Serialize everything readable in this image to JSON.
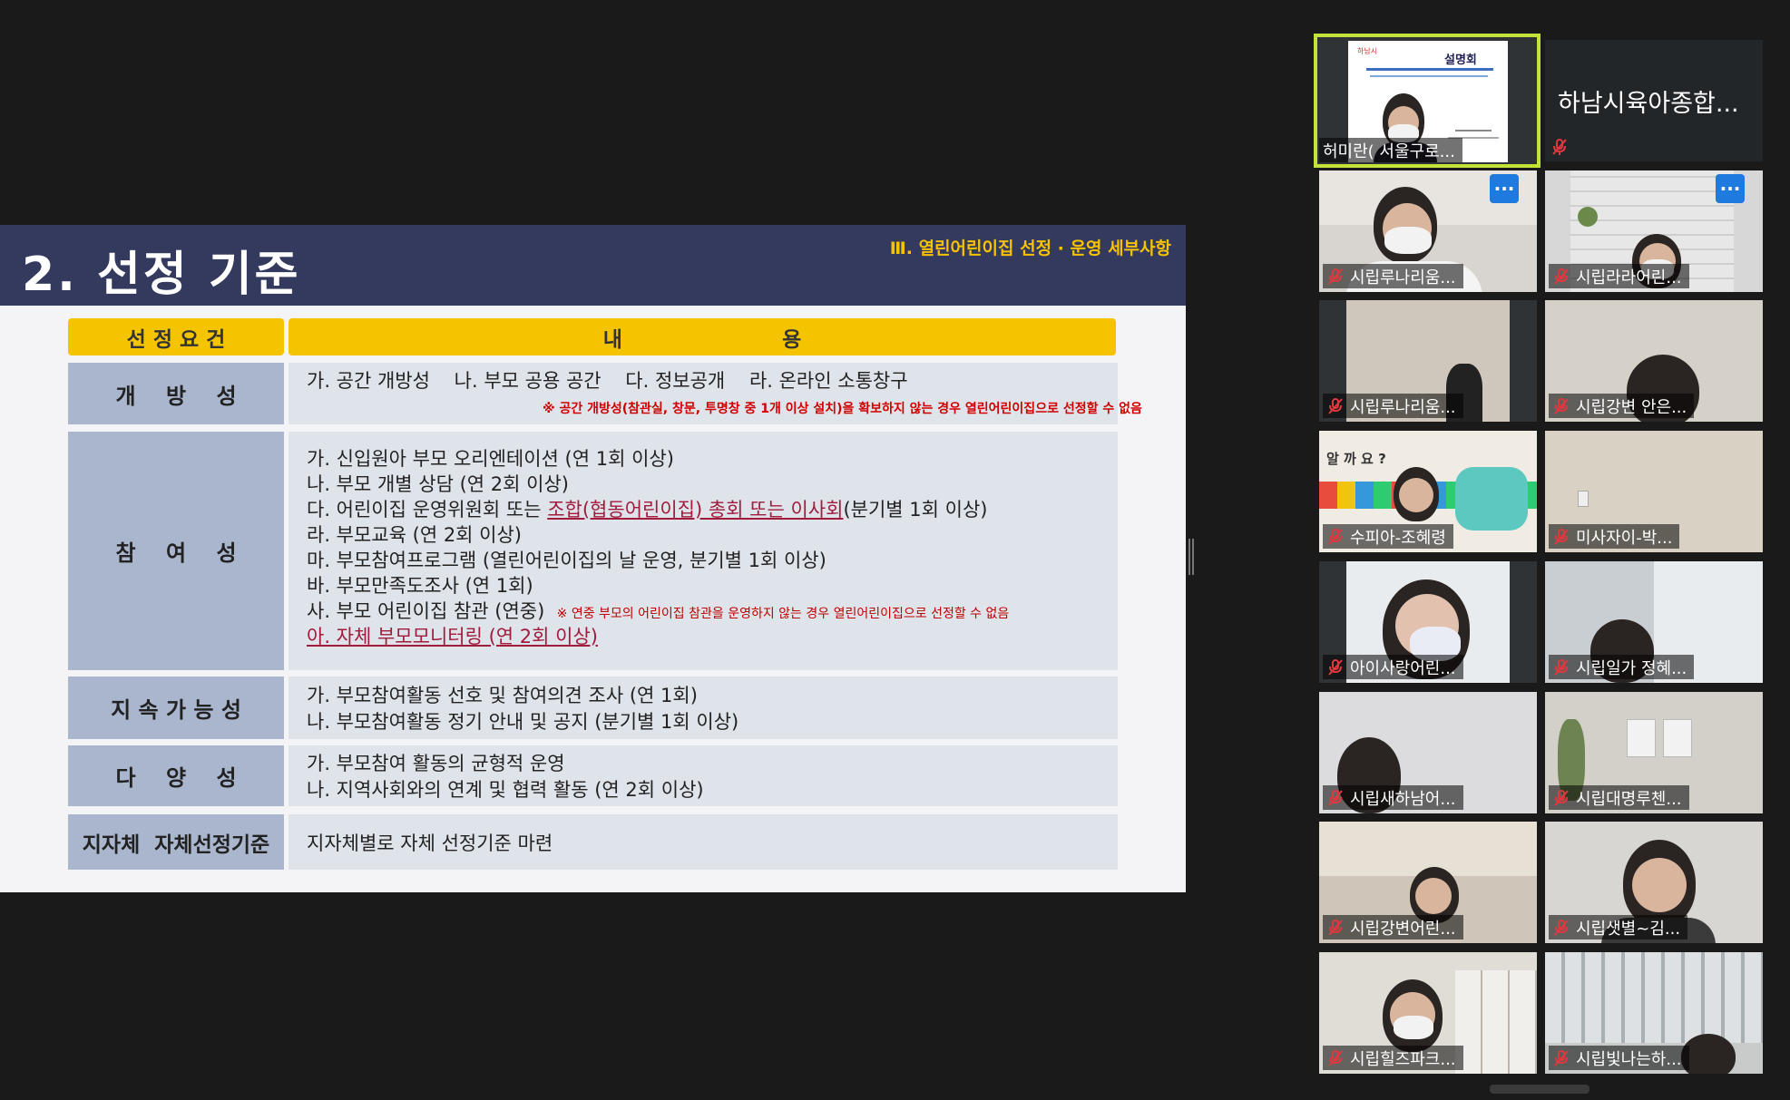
{
  "slide": {
    "title": "2. 선정 기준",
    "section": "Ⅲ. 열린어린이집 선정 · 운영 세부사항",
    "table": {
      "header_criteria": "선 정 요 건",
      "header_content": "내                      용",
      "rows": [
        {
          "label": "개    방    성",
          "line1": "가. 공간 개방성    나. 부모 공용 공간    다. 정보공개    라. 온라인 소통창구",
          "note": "※ 공간 개방성(참관실, 창문, 투명창 중 1개 이상 설치)을 확보하지 않는 경우 열린어린이집으로 선정할 수 없음"
        },
        {
          "label": "참    여    성",
          "items": [
            "가. 신입원아 부모 오리엔테이션 (연 1회 이상)",
            "나. 부모 개별 상담 (연 2회 이상)"
          ],
          "item_da_prefix": "다. 어린이집 운영위원회 또는 ",
          "item_da_highlight": "조합(협동어린이집) 총회 또는 이사회",
          "item_da_suffix": "(분기별 1회 이상)",
          "items2": [
            "라. 부모교육 (연 2회 이상)",
            "마. 부모참여프로그램 (열린어린이집의 날 운영, 분기별 1회 이상)",
            "바. 부모만족도조사 (연 1회)"
          ],
          "item_sa": "사. 부모 어린이집 참관 (연중)",
          "item_sa_note": "※ 연중 부모의 어린이집 참관을 운영하지 않는 경우 열린어린이집으로 선정할 수 없음",
          "item_a": "아. 자체 부모모니터링 (연 2회 이상)"
        },
        {
          "label": "지 속 가 능 성",
          "items": [
            "가. 부모참여활동 선호 및 참여의견 조사 (연 1회)",
            "나. 부모참여활동 정기 안내 및 공지 (분기별 1회 이상)"
          ]
        },
        {
          "label": "다    양    성",
          "items": [
            "가. 부모참여 활동의 균형적 운영",
            "나. 지역사회와의 연계 및 협력 활동 (연 2회 이상)"
          ]
        },
        {
          "label": "지자체  자체선정기준",
          "items": [
            "지자체별로 자체 선정기준 마련"
          ]
        }
      ]
    }
  },
  "gallery": {
    "active_speaker": {
      "name": "허미란( 서울구로...",
      "slide_title": "설명회",
      "slide_top": "하남시"
    },
    "name_only_tile": "하남시육아종합...",
    "tiles": [
      {
        "name": "시립루나리움...",
        "more": "···"
      },
      {
        "name": "시립라라어린...",
        "more": "···"
      },
      {
        "name": "시립루나리움..."
      },
      {
        "name": "시립강변 안은..."
      },
      {
        "name": "수피아-조혜령",
        "banner": "알 까 요 ?"
      },
      {
        "name": "미사자이-박..."
      },
      {
        "name": "아이사랑어린..."
      },
      {
        "name": "시립일가 정혜..."
      },
      {
        "name": "시립새하남어..."
      },
      {
        "name": "시립대명루첸..."
      },
      {
        "name": "시립강변어린..."
      },
      {
        "name": "시립샛별~김..."
      },
      {
        "name": "시립힐즈파크..."
      },
      {
        "name": "시립빛나는하..."
      }
    ]
  },
  "icons": {
    "muted_mic": "mic-off-icon",
    "more": "more-options-icon"
  },
  "colors": {
    "slide_header": "#343a5e",
    "table_header": "#f5c400",
    "label_cell": "#a9b6cd",
    "content_cell": "#dfe3ea",
    "active_border": "#c4e33a",
    "more_button": "#1f7ae0"
  }
}
